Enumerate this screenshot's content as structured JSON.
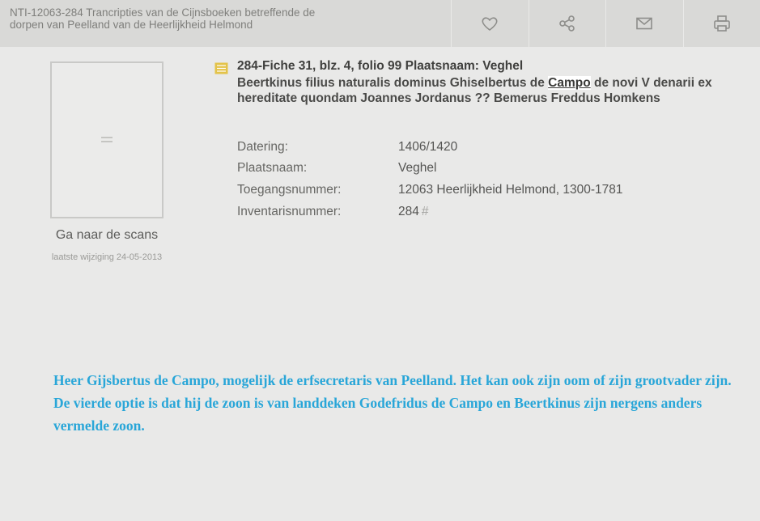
{
  "header": {
    "title_line1": "NTI-12063-284 Trancripties van de Cijnsboeken betreffende de",
    "title_line2": "dorpen van Peelland van de Heerlijkheid Helmond",
    "actions": [
      {
        "icon": "heart-icon"
      },
      {
        "icon": "share-icon"
      },
      {
        "icon": "mail-icon"
      },
      {
        "icon": "print-icon"
      }
    ]
  },
  "thumbnail": {
    "link_label": "Ga naar de scans",
    "modified": "laatste wijziging 24-05-2013"
  },
  "record": {
    "title": "284-Fiche 31, blz. 4, folio 99 Plaatsnaam: Veghel",
    "desc_before": "Beertkinus filius naturalis dominus Ghiselbertus de ",
    "desc_highlight": "Campo",
    "desc_after": " de novi V denarii ex hereditate quondam Joannes Jordanus ?? Bemerus Freddus Homkens",
    "fields": [
      {
        "label": "Datering:",
        "value": "1406/1420"
      },
      {
        "label": "Plaatsnaam:",
        "value": "Veghel"
      },
      {
        "label": "Toegangsnummer:",
        "value": "12063 Heerlijkheid Helmond, 1300-1781"
      },
      {
        "label": "Inventarisnummer:",
        "value": "284",
        "suffix": "#"
      }
    ]
  },
  "note": "Heer Gijsbertus de Campo, mogelijk de erfsecretaris van Peelland. Het kan ook zijn oom of zijn grootvader zijn. De vierde optie is dat hij de zoon is van landdeken Godefridus de Campo en Beertkinus zijn nergens anders vermelde zoon.",
  "colors": {
    "note_text": "#29a6d8",
    "header_bg": "#d9d9d7",
    "page_bg": "#e9e9e8",
    "record_icon": "#e3c34a"
  }
}
